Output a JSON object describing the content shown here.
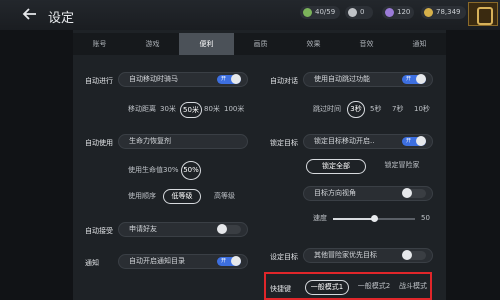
{
  "header": {
    "title": "设定",
    "resources": [
      {
        "name": "stamina",
        "value": "40/59",
        "color": "#7bb35a"
      },
      {
        "name": "silver",
        "value": "0",
        "color": "#bfc2c6"
      },
      {
        "name": "gem",
        "value": "120",
        "color": "#9b7bd8"
      },
      {
        "name": "gold",
        "value": "78,349",
        "color": "#d6b04a"
      }
    ]
  },
  "tabs": [
    "账号",
    "游戏",
    "便利",
    "画质",
    "效果",
    "音效",
    "通知"
  ],
  "active_tab": "便利",
  "left": {
    "auto_move": {
      "label": "自动进行",
      "toggle_text": "自动移动时骑马",
      "toggle_state": "开",
      "distance_label": "移动距离",
      "distance_options": [
        "30米",
        "50米",
        "80米",
        "100米"
      ],
      "distance_selected": "50米"
    },
    "auto_use": {
      "label": "自动使用",
      "potion_button": "生命力恢复剂",
      "hp_label": "使用生命值",
      "hp_options": [
        "30%",
        "50%"
      ],
      "hp_selected": "50%",
      "order_label": "使用顺序",
      "order_options": [
        "低等级",
        "高等级"
      ],
      "order_selected": "低等级"
    },
    "auto_accept": {
      "label": "自动接受",
      "toggle_text": "申请好友"
    },
    "notify": {
      "label": "通知",
      "toggle_text": "自动开启通知目录",
      "toggle_state": "开"
    }
  },
  "right": {
    "auto_dialog": {
      "label": "自动对话",
      "toggle_text": "使用自动跳过功能",
      "toggle_state": "开",
      "skip_label": "跳过时间",
      "skip_options": [
        "3秒",
        "5秒",
        "7秒",
        "10秒"
      ],
      "skip_selected": "3秒"
    },
    "lock_target": {
      "label": "锁定目标",
      "toggle_text": "锁定目标移动开启..",
      "toggle_state": "开",
      "lock_all": "锁定全部",
      "lock_hostile": "锁定冒险家",
      "direction_text": "目标方向视角",
      "speed_label": "速度",
      "speed_value": "50",
      "speed_fraction": 0.5
    },
    "set_target": {
      "label": "设定目标",
      "toggle_text": "其他冒险家优先目标"
    },
    "shortcut": {
      "label": "快捷键",
      "modes": [
        "一般模式1",
        "一般模式2",
        "战斗模式"
      ],
      "selected": "一般模式1"
    }
  }
}
